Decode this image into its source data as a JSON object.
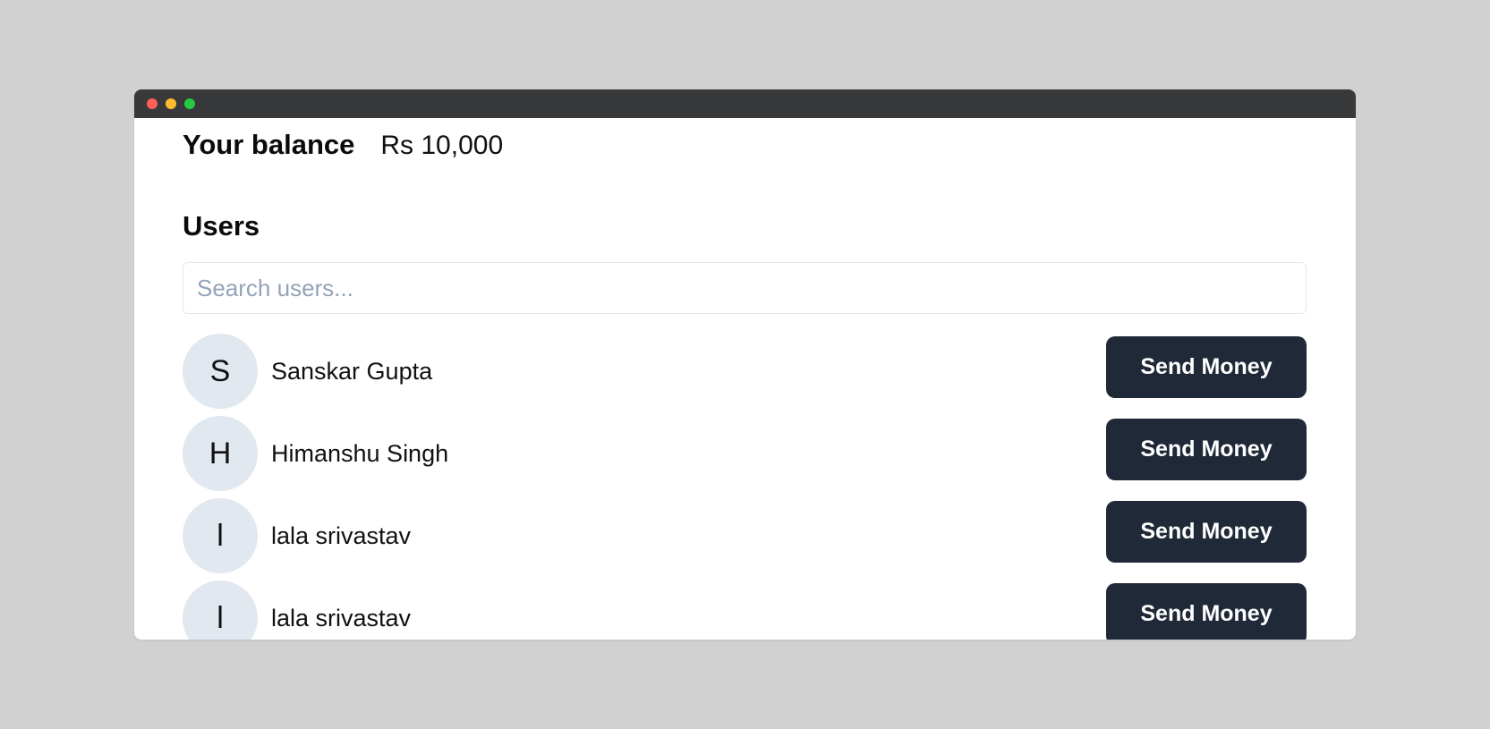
{
  "balance": {
    "label": "Your balance",
    "value": "Rs 10,000"
  },
  "users_section": {
    "heading": "Users",
    "search_placeholder": "Search users..."
  },
  "users": [
    {
      "initial": "S",
      "name": "Sanskar Gupta",
      "action": "Send Money"
    },
    {
      "initial": "H",
      "name": "Himanshu Singh",
      "action": "Send Money"
    },
    {
      "initial": "l",
      "name": "lala srivastav",
      "action": "Send Money"
    },
    {
      "initial": "l",
      "name": "lala srivastav",
      "action": "Send Money"
    }
  ],
  "colors": {
    "button_bg": "#1f2937",
    "avatar_bg": "#e2e8f0",
    "titlebar": "#38393b"
  }
}
